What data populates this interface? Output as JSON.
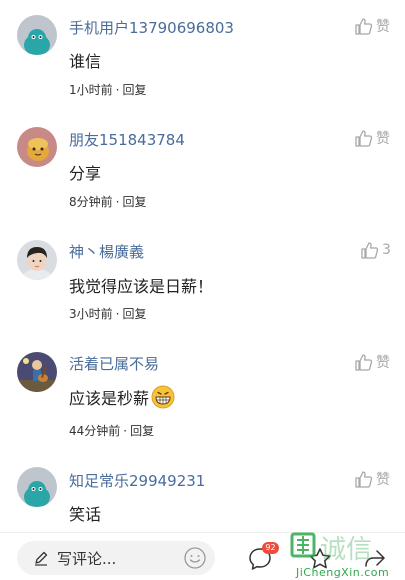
{
  "comments": [
    {
      "username": "手机用户13790696803",
      "content": "谁信",
      "time": "1小时前",
      "separator": "·",
      "reply_label": "回复",
      "like_label": "赞",
      "avatar": "default-teal-avatar"
    },
    {
      "username": "朋友151843784",
      "content": "分享",
      "time": "8分钟前",
      "separator": "·",
      "reply_label": "回复",
      "like_label": "赞",
      "avatar": "pink-bread-avatar"
    },
    {
      "username": "神丶楊廣義",
      "content": "我觉得应该是日薪！",
      "time": "3小时前",
      "separator": "·",
      "reply_label": "回复",
      "like_label": "3",
      "avatar": "child-photo-avatar"
    },
    {
      "username": "活着已属不易",
      "content": "应该是秒薪",
      "content_emoji": "grinning-face-emoji",
      "time": "44分钟前",
      "separator": "·",
      "reply_label": "回复",
      "like_label": "赞",
      "avatar": "cartoon-guitar-avatar"
    },
    {
      "username": "知足常乐29949231",
      "content": "笑话",
      "like_label": "赞",
      "avatar": "default-teal-avatar"
    }
  ],
  "bottom_bar": {
    "placeholder": "写评论...",
    "comment_badge": "92",
    "icons": [
      "pen-icon",
      "emoji-icon",
      "comment-icon",
      "star-icon",
      "share-icon"
    ]
  },
  "watermark": {
    "text": "集诚信",
    "url": "JiChengXin.com"
  },
  "colors": {
    "username": "#4a6c9b",
    "badge": "#f04a3c",
    "teal_avatar": "#2aa5a8",
    "watermark": "#2ea84a"
  }
}
